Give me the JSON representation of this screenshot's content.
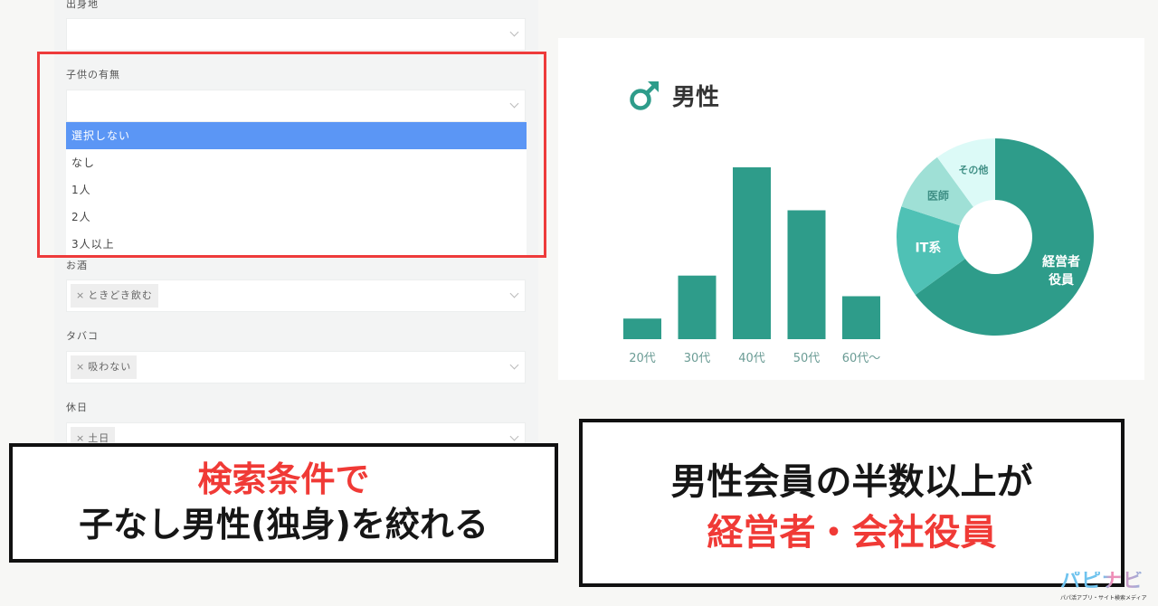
{
  "form": {
    "fields": [
      {
        "label": "出身地",
        "value": ""
      },
      {
        "label": "子供の有無",
        "value": "",
        "dropdown_open": true,
        "options": [
          "選択しない",
          "なし",
          "1人",
          "2人",
          "3人以上"
        ],
        "highlighted_option": "選択しない"
      },
      {
        "label": "お酒",
        "tags": [
          "ときどき飲む"
        ]
      },
      {
        "label": "タバコ",
        "tags": [
          "吸わない"
        ]
      },
      {
        "label": "休日",
        "tags": [
          "土日"
        ]
      }
    ],
    "tag_remove_glyph": "×"
  },
  "chart_card": {
    "title": "男性",
    "title_icon": "male-symbol-icon",
    "accent_color": "#2e9c8a"
  },
  "chart_data": [
    {
      "type": "bar",
      "title": "",
      "categories": [
        "20代",
        "30代",
        "40代",
        "50代",
        "60代〜"
      ],
      "values": [
        12,
        37,
        100,
        75,
        25
      ],
      "units": "relative (no axis shown)",
      "xlabel": "",
      "ylabel": "",
      "ylim": [
        0,
        100
      ],
      "grid": false,
      "color": "#2e9c8a"
    },
    {
      "type": "pie",
      "donut": true,
      "labels": [
        "経営者\n役員",
        "IT系",
        "医師",
        "その他"
      ],
      "label_lines": [
        [
          "経営者",
          "役員"
        ],
        [
          "IT系"
        ],
        [
          "医師"
        ],
        [
          "その他"
        ]
      ],
      "values": [
        65,
        15,
        10,
        10
      ],
      "colors": [
        "#2e9c8a",
        "#4fc1b5",
        "#9fe0d6",
        "#dcfaf7"
      ],
      "label_colors": [
        "#ffffff",
        "#ffffff",
        "#3f8f85",
        "#3f8f85"
      ]
    }
  ],
  "captions": {
    "left": {
      "line1": "検索条件で",
      "line2": "子なし男性(独身)を絞れる"
    },
    "right": {
      "line1": "男性会員の半数以上が",
      "line2": "経営者・会社役員"
    }
  },
  "logo": {
    "mark": "パピナビ",
    "tagline": "パパ活アプリ・サイト検索メディア"
  },
  "colors": {
    "highlight_red": "#ee3b3b",
    "select_blue": "#5b96f5",
    "caption_red": "#f03a36"
  }
}
